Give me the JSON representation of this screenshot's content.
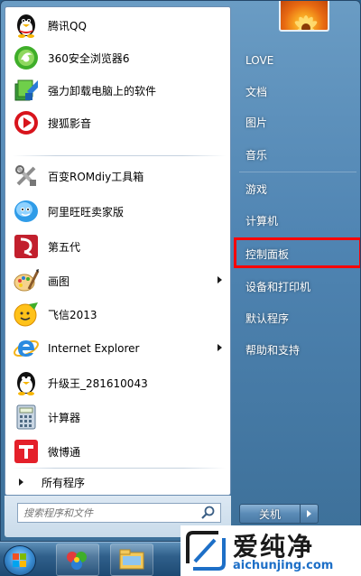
{
  "programs": [
    {
      "label": "腾讯QQ",
      "icon": "qq-penguin-icon",
      "arrow": false
    },
    {
      "label": "360安全浏览器6",
      "icon": "360-browser-icon",
      "arrow": false
    },
    {
      "label": "强力卸载电脑上的软件",
      "icon": "uninstall-tool-icon",
      "arrow": false
    },
    {
      "label": "搜狐影音",
      "icon": "sohu-video-icon",
      "arrow": false
    },
    {
      "label": "百变ROMdiy工具箱",
      "icon": "rom-tool-icon",
      "arrow": false
    },
    {
      "label": "阿里旺旺卖家版",
      "icon": "aliwangwang-icon",
      "arrow": false
    },
    {
      "label": "第五代",
      "icon": "fifth-gen-icon",
      "arrow": false
    },
    {
      "label": "画图",
      "icon": "paint-icon",
      "arrow": true
    },
    {
      "label": "飞信2013",
      "icon": "fetion-icon",
      "arrow": false
    },
    {
      "label": "Internet Explorer",
      "icon": "internet-explorer-icon",
      "arrow": true
    },
    {
      "label": "升级王_281610043",
      "icon": "penguin-icon",
      "arrow": false
    },
    {
      "label": "计算器",
      "icon": "calculator-icon",
      "arrow": false
    },
    {
      "label": "微博通",
      "icon": "weibotong-icon",
      "arrow": false
    }
  ],
  "all_programs": "所有程序",
  "search": {
    "placeholder": "搜索程序和文件"
  },
  "right_items": [
    {
      "label": "LOVE"
    },
    {
      "label": "文档"
    },
    {
      "label": "图片"
    },
    {
      "label": "音乐"
    },
    {
      "label": "游戏"
    },
    {
      "label": "计算机"
    },
    {
      "label": "控制面板"
    },
    {
      "label": "设备和打印机"
    },
    {
      "label": "默认程序"
    },
    {
      "label": "帮助和支持"
    }
  ],
  "shutdown": {
    "label": "关机"
  },
  "highlight_color": "#ff0000",
  "watermark": {
    "title": "爱纯净",
    "url": "aichunjing.com"
  }
}
